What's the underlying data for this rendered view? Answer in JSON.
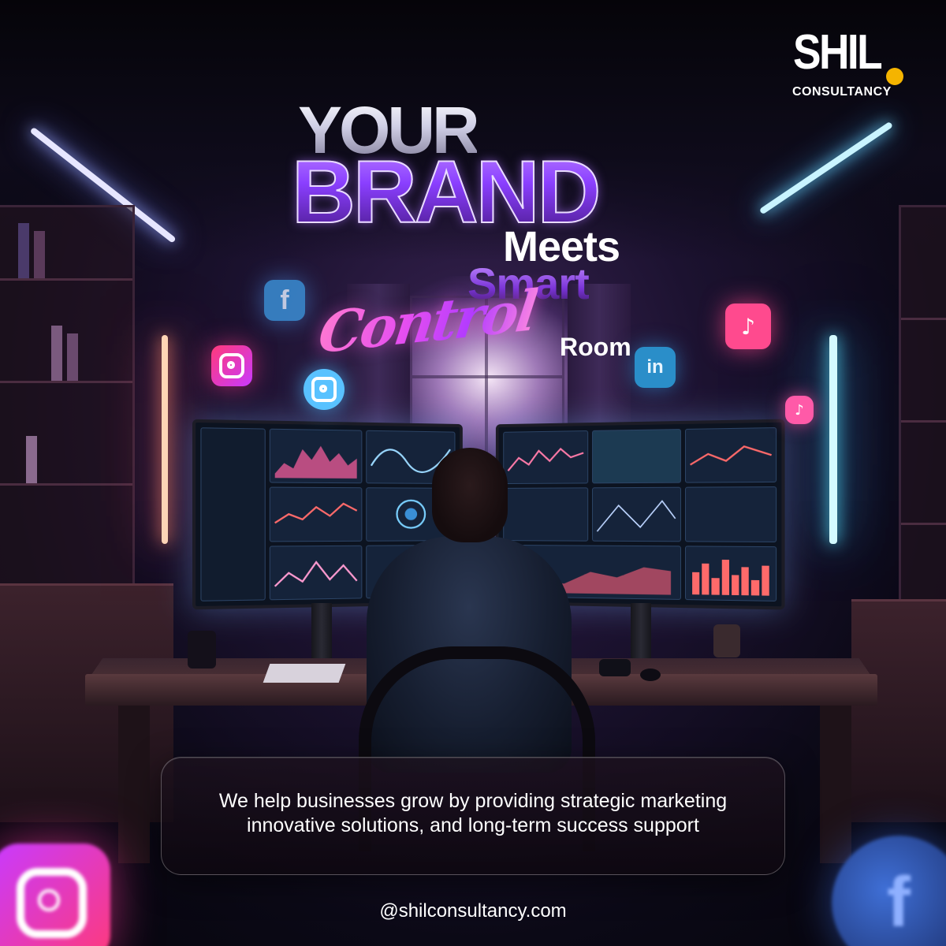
{
  "brand": {
    "logo_main": "SHIL",
    "logo_sub": "CONSULTANCY",
    "accent_color": "#f5b400"
  },
  "headline": {
    "line1": "YOUR",
    "line2": "BRAND",
    "line3": "Meets",
    "line4": "Smart",
    "line5_script": "Control",
    "line5_suffix": "Room"
  },
  "card": {
    "line1": "We help businesses grow by providing strategic marketing",
    "line2": "innovative solutions, and long-term success support"
  },
  "footer": {
    "handle": "@shilconsultancy.com"
  },
  "social_icons": [
    "facebook-icon",
    "instagram-icon",
    "tiktok-icon",
    "linkedin-icon"
  ],
  "colors": {
    "brand_purple": "#8a3fff",
    "script_pink": "#e64ff0",
    "background": "#0b0916"
  }
}
